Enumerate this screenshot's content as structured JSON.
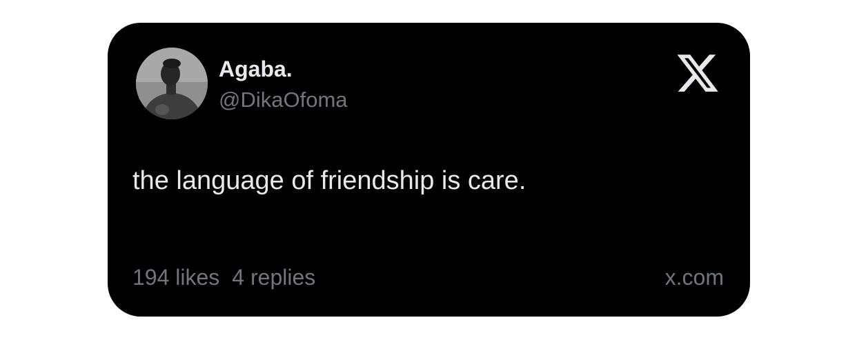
{
  "author": {
    "display_name": "Agaba.",
    "handle": "@DikaOfoma"
  },
  "tweet": {
    "text": "the language of friendship is care."
  },
  "stats": {
    "likes": "194 likes",
    "replies": "4 replies"
  },
  "source": {
    "domain": "x.com",
    "logo_icon": "x-logo-icon"
  },
  "colors": {
    "card_background": "#000000",
    "primary_text": "#e7e9ea",
    "secondary_text": "#71767b"
  }
}
